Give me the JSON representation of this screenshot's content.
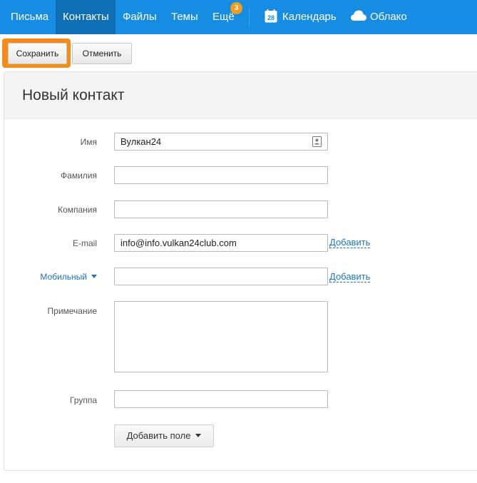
{
  "nav": {
    "mail": "Письма",
    "contacts": "Контакты",
    "files": "Файлы",
    "themes": "Темы",
    "more": "Ещё",
    "more_badge": "3",
    "calendar": "Календарь",
    "calendar_day": "28",
    "cloud": "Облако"
  },
  "toolbar": {
    "save_label": "Сохранить",
    "cancel_label": "Отменить"
  },
  "form": {
    "title": "Новый контакт",
    "first_name": {
      "label": "Имя",
      "value": "Вулкан24"
    },
    "last_name": {
      "label": "Фамилия",
      "value": ""
    },
    "company": {
      "label": "Компания",
      "value": ""
    },
    "email": {
      "label": "E-mail",
      "value": "info@info.vulkan24club.com",
      "add_label": "Добавить"
    },
    "phone": {
      "label": "Мобильный",
      "value": "",
      "add_label": "Добавить"
    },
    "note": {
      "label": "Примечание",
      "value": ""
    },
    "group": {
      "label": "Группа",
      "value": ""
    },
    "add_field_label": "Добавить поле"
  },
  "colors": {
    "nav_bg": "#168de2",
    "nav_active": "#0f6fb4",
    "save_highlight": "#f48b1b",
    "badge": "#f59c1a",
    "link": "#1a73c9"
  }
}
